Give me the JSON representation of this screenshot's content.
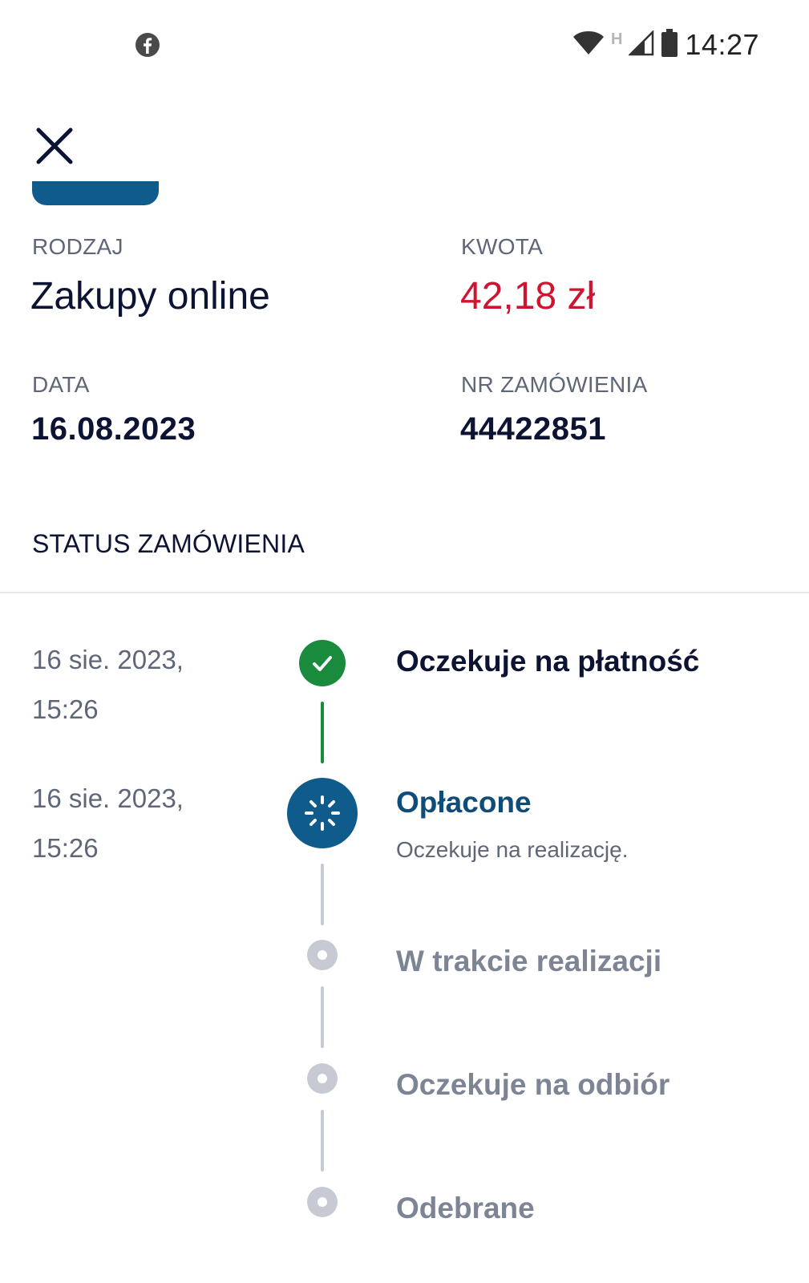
{
  "status_bar": {
    "time": "14:27",
    "network_label": "H",
    "icons": [
      "facebook-icon",
      "wifi-icon",
      "signal-icon",
      "battery-icon"
    ]
  },
  "details": {
    "type_label": "RODZAJ",
    "type_value": "Zakupy online",
    "amount_label": "KWOTA",
    "amount_value": "42,18 zł",
    "date_label": "DATA",
    "date_value": "16.08.2023",
    "order_label": "NR ZAMÓWIENIA",
    "order_value": "44422851"
  },
  "order_status": {
    "title": "STATUS ZAMÓWIENIA",
    "steps": [
      {
        "date": "16 sie. 2023,",
        "time": "15:26",
        "label": "Oczekuje na płatność",
        "state": "done"
      },
      {
        "date": "16 sie. 2023,",
        "time": "15:26",
        "label": "Opłacone",
        "sub": "Oczekuje na realizację.",
        "state": "active"
      },
      {
        "label": "W trakcie realizacji",
        "state": "pending"
      },
      {
        "label": "Oczekuje na odbiór",
        "state": "pending"
      },
      {
        "label": "Odebrane",
        "state": "pending"
      }
    ]
  },
  "colors": {
    "primary": "#0f5c8c",
    "success": "#1a8a3c",
    "amount_red": "#cc1530",
    "text_dark": "#0d1333",
    "text_muted": "#5f6677",
    "pending": "#c7cad2"
  }
}
